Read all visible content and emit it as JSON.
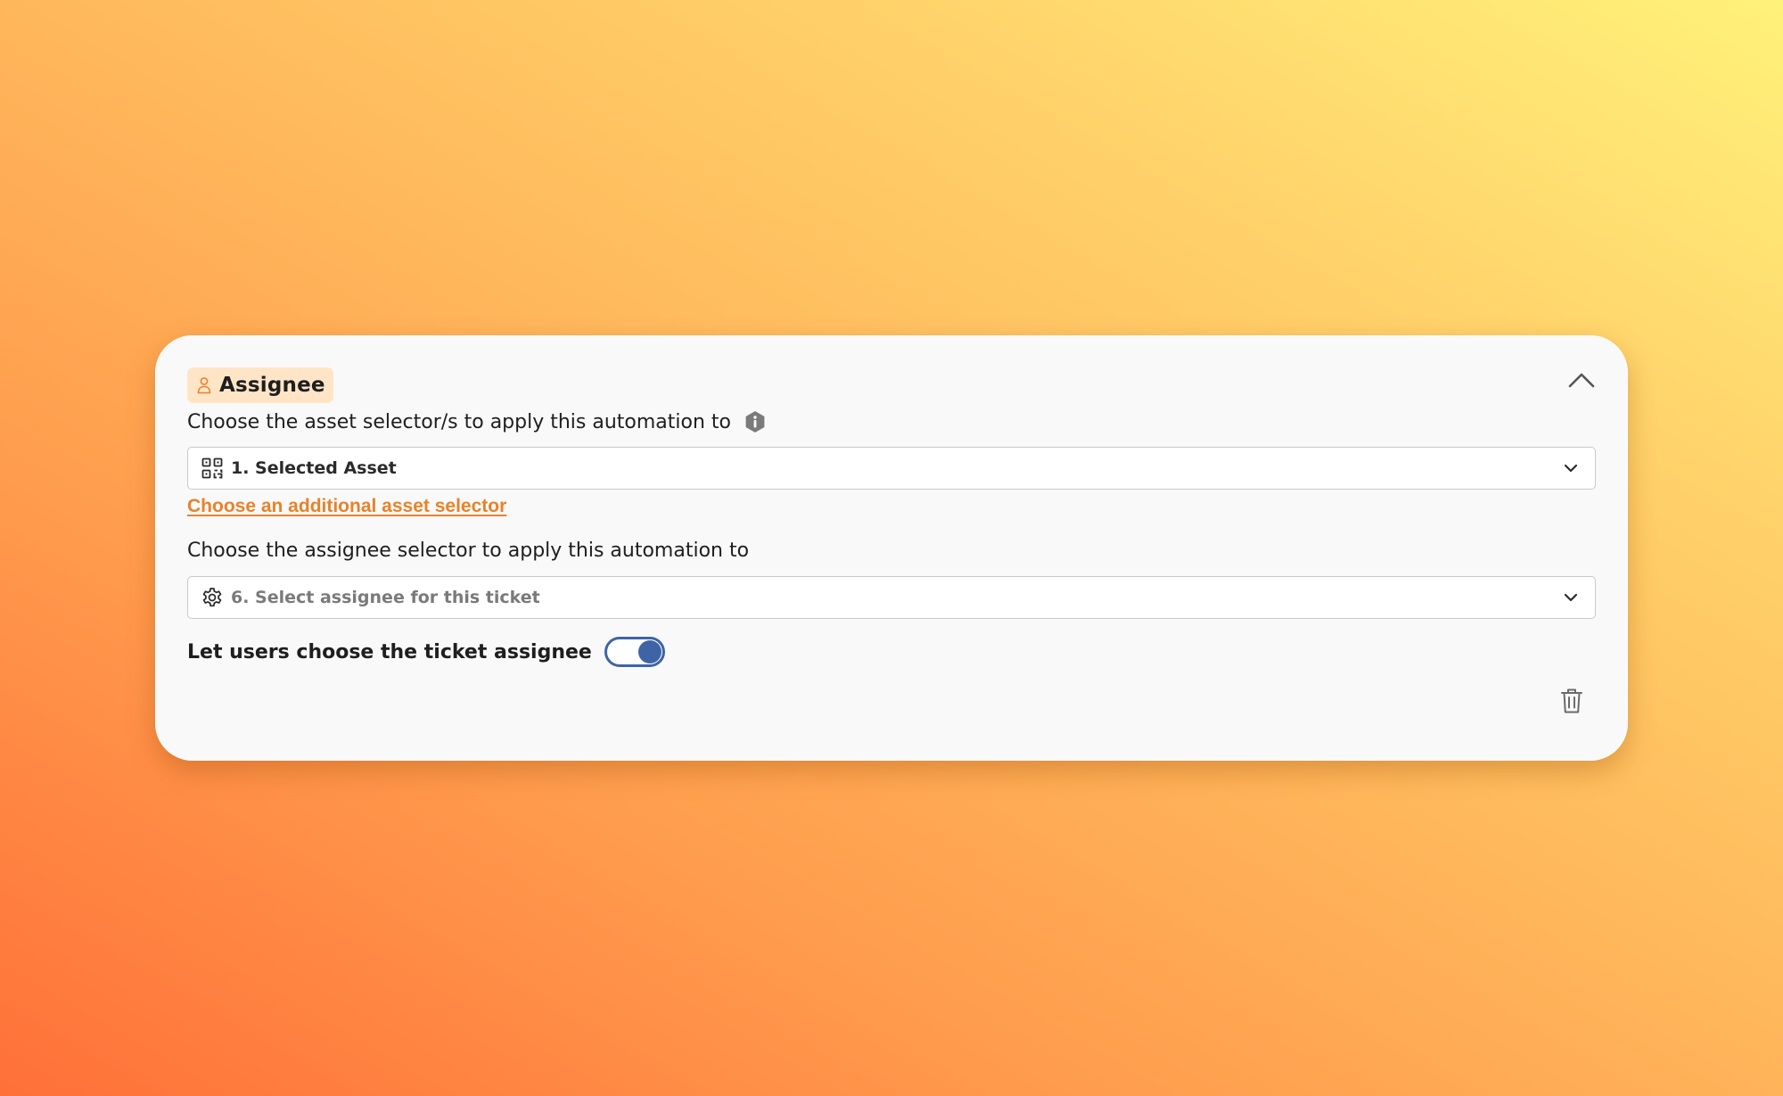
{
  "colors": {
    "accent_orange": "#e8822a",
    "tag_background": "#ffe5c6",
    "toggle_blue": "#3f64a6",
    "card_background": "#f9f9f9"
  },
  "section": {
    "title": "Assignee",
    "icon": "user-icon",
    "collapse_icon": "chevron-up-icon"
  },
  "asset_selector": {
    "label": "Choose the asset selector/s to apply this automation to",
    "info_icon": "info-icon",
    "icon": "qr-code-icon",
    "selected_value": "1. Selected Asset",
    "add_link": "Choose an additional asset selector"
  },
  "assignee_selector": {
    "label": "Choose the assignee selector to apply this automation to",
    "icon": "gear-icon",
    "selected_value": "6. Select assignee for this ticket"
  },
  "user_choice": {
    "label": "Let users choose the ticket assignee",
    "enabled": true
  },
  "actions": {
    "delete_icon": "trash-icon"
  }
}
